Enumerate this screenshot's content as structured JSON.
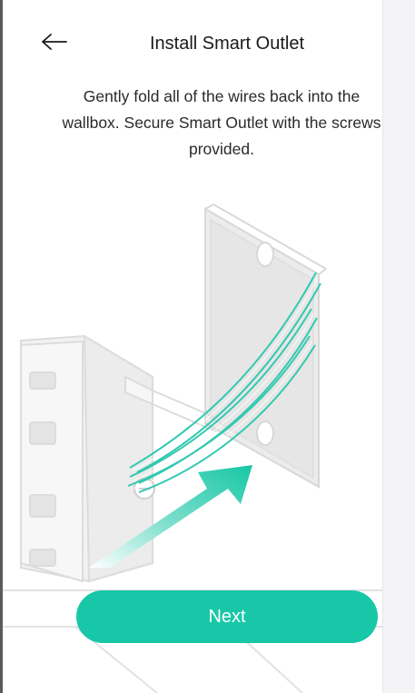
{
  "header": {
    "title": "Install Smart Outlet",
    "back_icon": "back-arrow-icon"
  },
  "instruction": {
    "text": "Gently fold all of the wires back into the wallbox. Secure Smart Outlet with the screws provided."
  },
  "illustration": {
    "description_icon": "outlet-wallbox-illustration"
  },
  "actions": {
    "next_label": "Next"
  },
  "colors": {
    "accent": "#18c7a7",
    "text": "#1a1a1a",
    "panel": "#f4f4f6"
  }
}
